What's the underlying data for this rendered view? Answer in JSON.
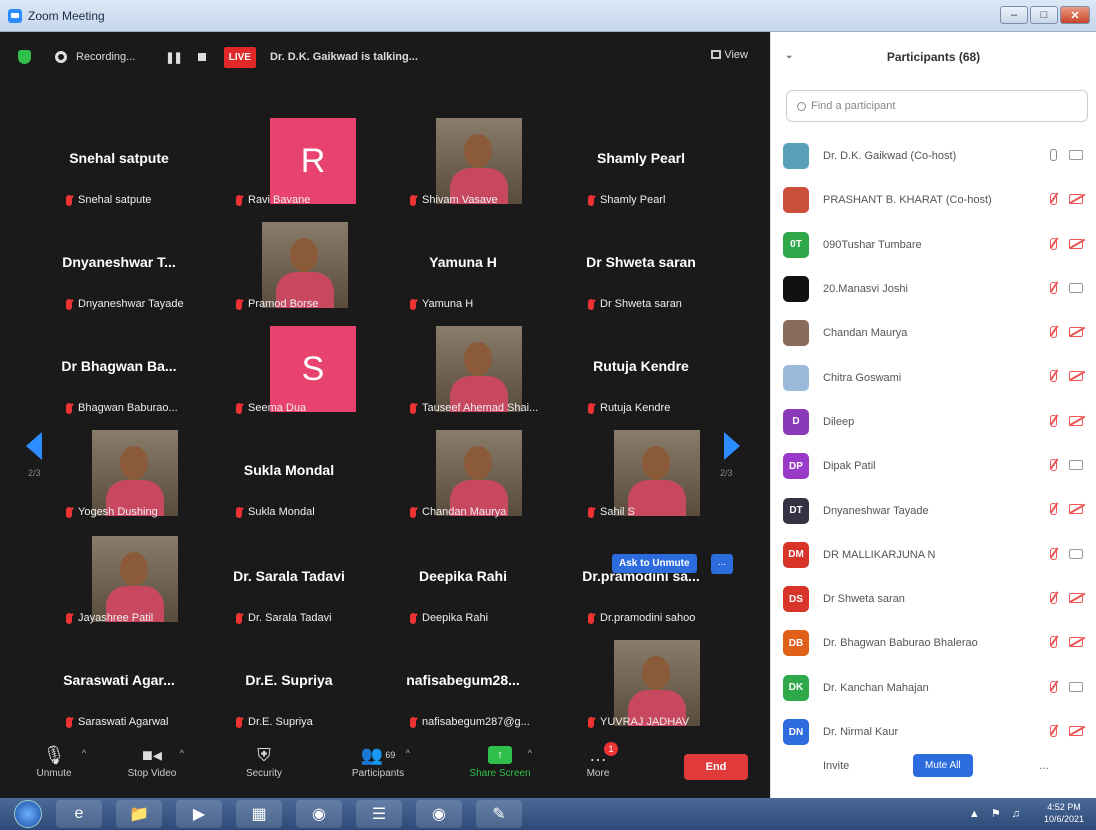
{
  "window": {
    "title": "Zoom Meeting"
  },
  "topbar": {
    "recording_label": "Recording...",
    "live_label": "LIVE",
    "talking": "Dr. D.K. Gaikwad is talking...",
    "view_label": "View"
  },
  "tiles": [
    {
      "big": "Snehal satpute",
      "label": "Snehal satpute",
      "kind": "name"
    },
    {
      "big": "R",
      "label": "Ravi Bavane",
      "kind": "letter"
    },
    {
      "big": "",
      "label": "Shivam Vasave",
      "kind": "photo"
    },
    {
      "big": "Shamly Pearl",
      "label": "Shamly Pearl",
      "kind": "name"
    },
    {
      "big": "Dnyaneshwar T...",
      "label": "Dnyaneshwar Tayade",
      "kind": "name"
    },
    {
      "big": "",
      "label": "Pramod Borse",
      "kind": "photo"
    },
    {
      "big": "Yamuna H",
      "label": "Yamuna H",
      "kind": "name"
    },
    {
      "big": "Dr Shweta saran",
      "label": "Dr Shweta saran",
      "kind": "name"
    },
    {
      "big": "Dr Bhagwan Ba...",
      "label": "Bhagwan Baburao...",
      "kind": "name"
    },
    {
      "big": "S",
      "label": "Seema Dua",
      "kind": "letter"
    },
    {
      "big": "",
      "label": "Tauseef Ahemad Shai...",
      "kind": "photo"
    },
    {
      "big": "Rutuja Kendre",
      "label": "Rutuja Kendre",
      "kind": "name"
    },
    {
      "big": "",
      "label": "Yogesh Dushing",
      "kind": "photo"
    },
    {
      "big": "Sukla Mondal",
      "label": "Sukla Mondal",
      "kind": "name"
    },
    {
      "big": "",
      "label": "Chandan Maurya",
      "kind": "photo"
    },
    {
      "big": "",
      "label": "Sahil S",
      "kind": "photo"
    },
    {
      "big": "",
      "label": "Jayashree Patil",
      "kind": "photo"
    },
    {
      "big": "Dr. Sarala Tadavi",
      "label": "Dr. Sarala Tadavi",
      "kind": "name"
    },
    {
      "big": "Deepika Rahi",
      "label": "Deepika Rahi",
      "kind": "name"
    },
    {
      "big": "Dr.pramodini sa...",
      "label": "Dr.pramodini sahoo",
      "kind": "name"
    },
    {
      "big": "Saraswati Agar...",
      "label": "Saraswati Agarwal",
      "kind": "name"
    },
    {
      "big": "Dr.E. Supriya",
      "label": "Dr.E. Supriya",
      "kind": "name"
    },
    {
      "big": "nafisabegum28...",
      "label": "nafisabegum287@g...",
      "kind": "name"
    },
    {
      "big": "",
      "label": "YUVRAJ JADHAV",
      "kind": "photo"
    }
  ],
  "pager": {
    "left": "2/3",
    "right": "2/3"
  },
  "ask_unmute": "Ask to Unmute",
  "more_dots": "...",
  "toolbar": {
    "unmute": "Unmute",
    "stop_video": "Stop Video",
    "security": "Security",
    "participants": "Participants",
    "participants_count": "69",
    "share_screen": "Share Screen",
    "more": "More",
    "more_badge": "1",
    "end": "End"
  },
  "panel": {
    "title": "Participants (68)",
    "search_placeholder": "Find a participant",
    "invite": "Invite",
    "mute_all": "Mute All",
    "more": "..."
  },
  "participants": [
    {
      "initials": "",
      "name": "Dr. D.K. Gaikwad (Co-host)",
      "color": "#5aa0b8",
      "mic": "on",
      "cam": "on"
    },
    {
      "initials": "",
      "name": "PRASHANT B. KHARAT (Co-host)",
      "color": "#c8503a",
      "mic": "muted",
      "cam": "off"
    },
    {
      "initials": "0T",
      "name": "090Tushar Tumbare",
      "color": "#2fa84a",
      "mic": "muted",
      "cam": "off"
    },
    {
      "initials": "",
      "name": "20.Manasvi Joshi",
      "color": "#111111",
      "mic": "muted",
      "cam": "on"
    },
    {
      "initials": "",
      "name": "Chandan Maurya",
      "color": "#8a6a5a",
      "mic": "muted",
      "cam": "off"
    },
    {
      "initials": "",
      "name": "Chitra Goswami",
      "color": "#9ab8d8",
      "mic": "muted",
      "cam": "off"
    },
    {
      "initials": "D",
      "name": "Dileep",
      "color": "#8a3ab8",
      "mic": "muted",
      "cam": "off"
    },
    {
      "initials": "DP",
      "name": "Dipak Patil",
      "color": "#9a3ac8",
      "mic": "muted",
      "cam": "on"
    },
    {
      "initials": "DT",
      "name": "Dnyaneshwar Tayade",
      "color": "#333344",
      "mic": "muted",
      "cam": "off"
    },
    {
      "initials": "DM",
      "name": "DR MALLIKARJUNA N",
      "color": "#d8342a",
      "mic": "muted",
      "cam": "on"
    },
    {
      "initials": "DS",
      "name": "Dr Shweta saran",
      "color": "#d8342a",
      "mic": "muted",
      "cam": "off"
    },
    {
      "initials": "DB",
      "name": "Dr. Bhagwan Baburao Bhalerao",
      "color": "#e0601a",
      "mic": "muted",
      "cam": "off"
    },
    {
      "initials": "DK",
      "name": "Dr. Kanchan Mahajan",
      "color": "#2fa84a",
      "mic": "muted",
      "cam": "on"
    },
    {
      "initials": "DN",
      "name": "Dr. Nirmal Kaur",
      "color": "#2d6cdf",
      "mic": "muted",
      "cam": "off"
    }
  ],
  "taskbar": {
    "time": "4:52 PM",
    "date": "10/6/2021"
  }
}
